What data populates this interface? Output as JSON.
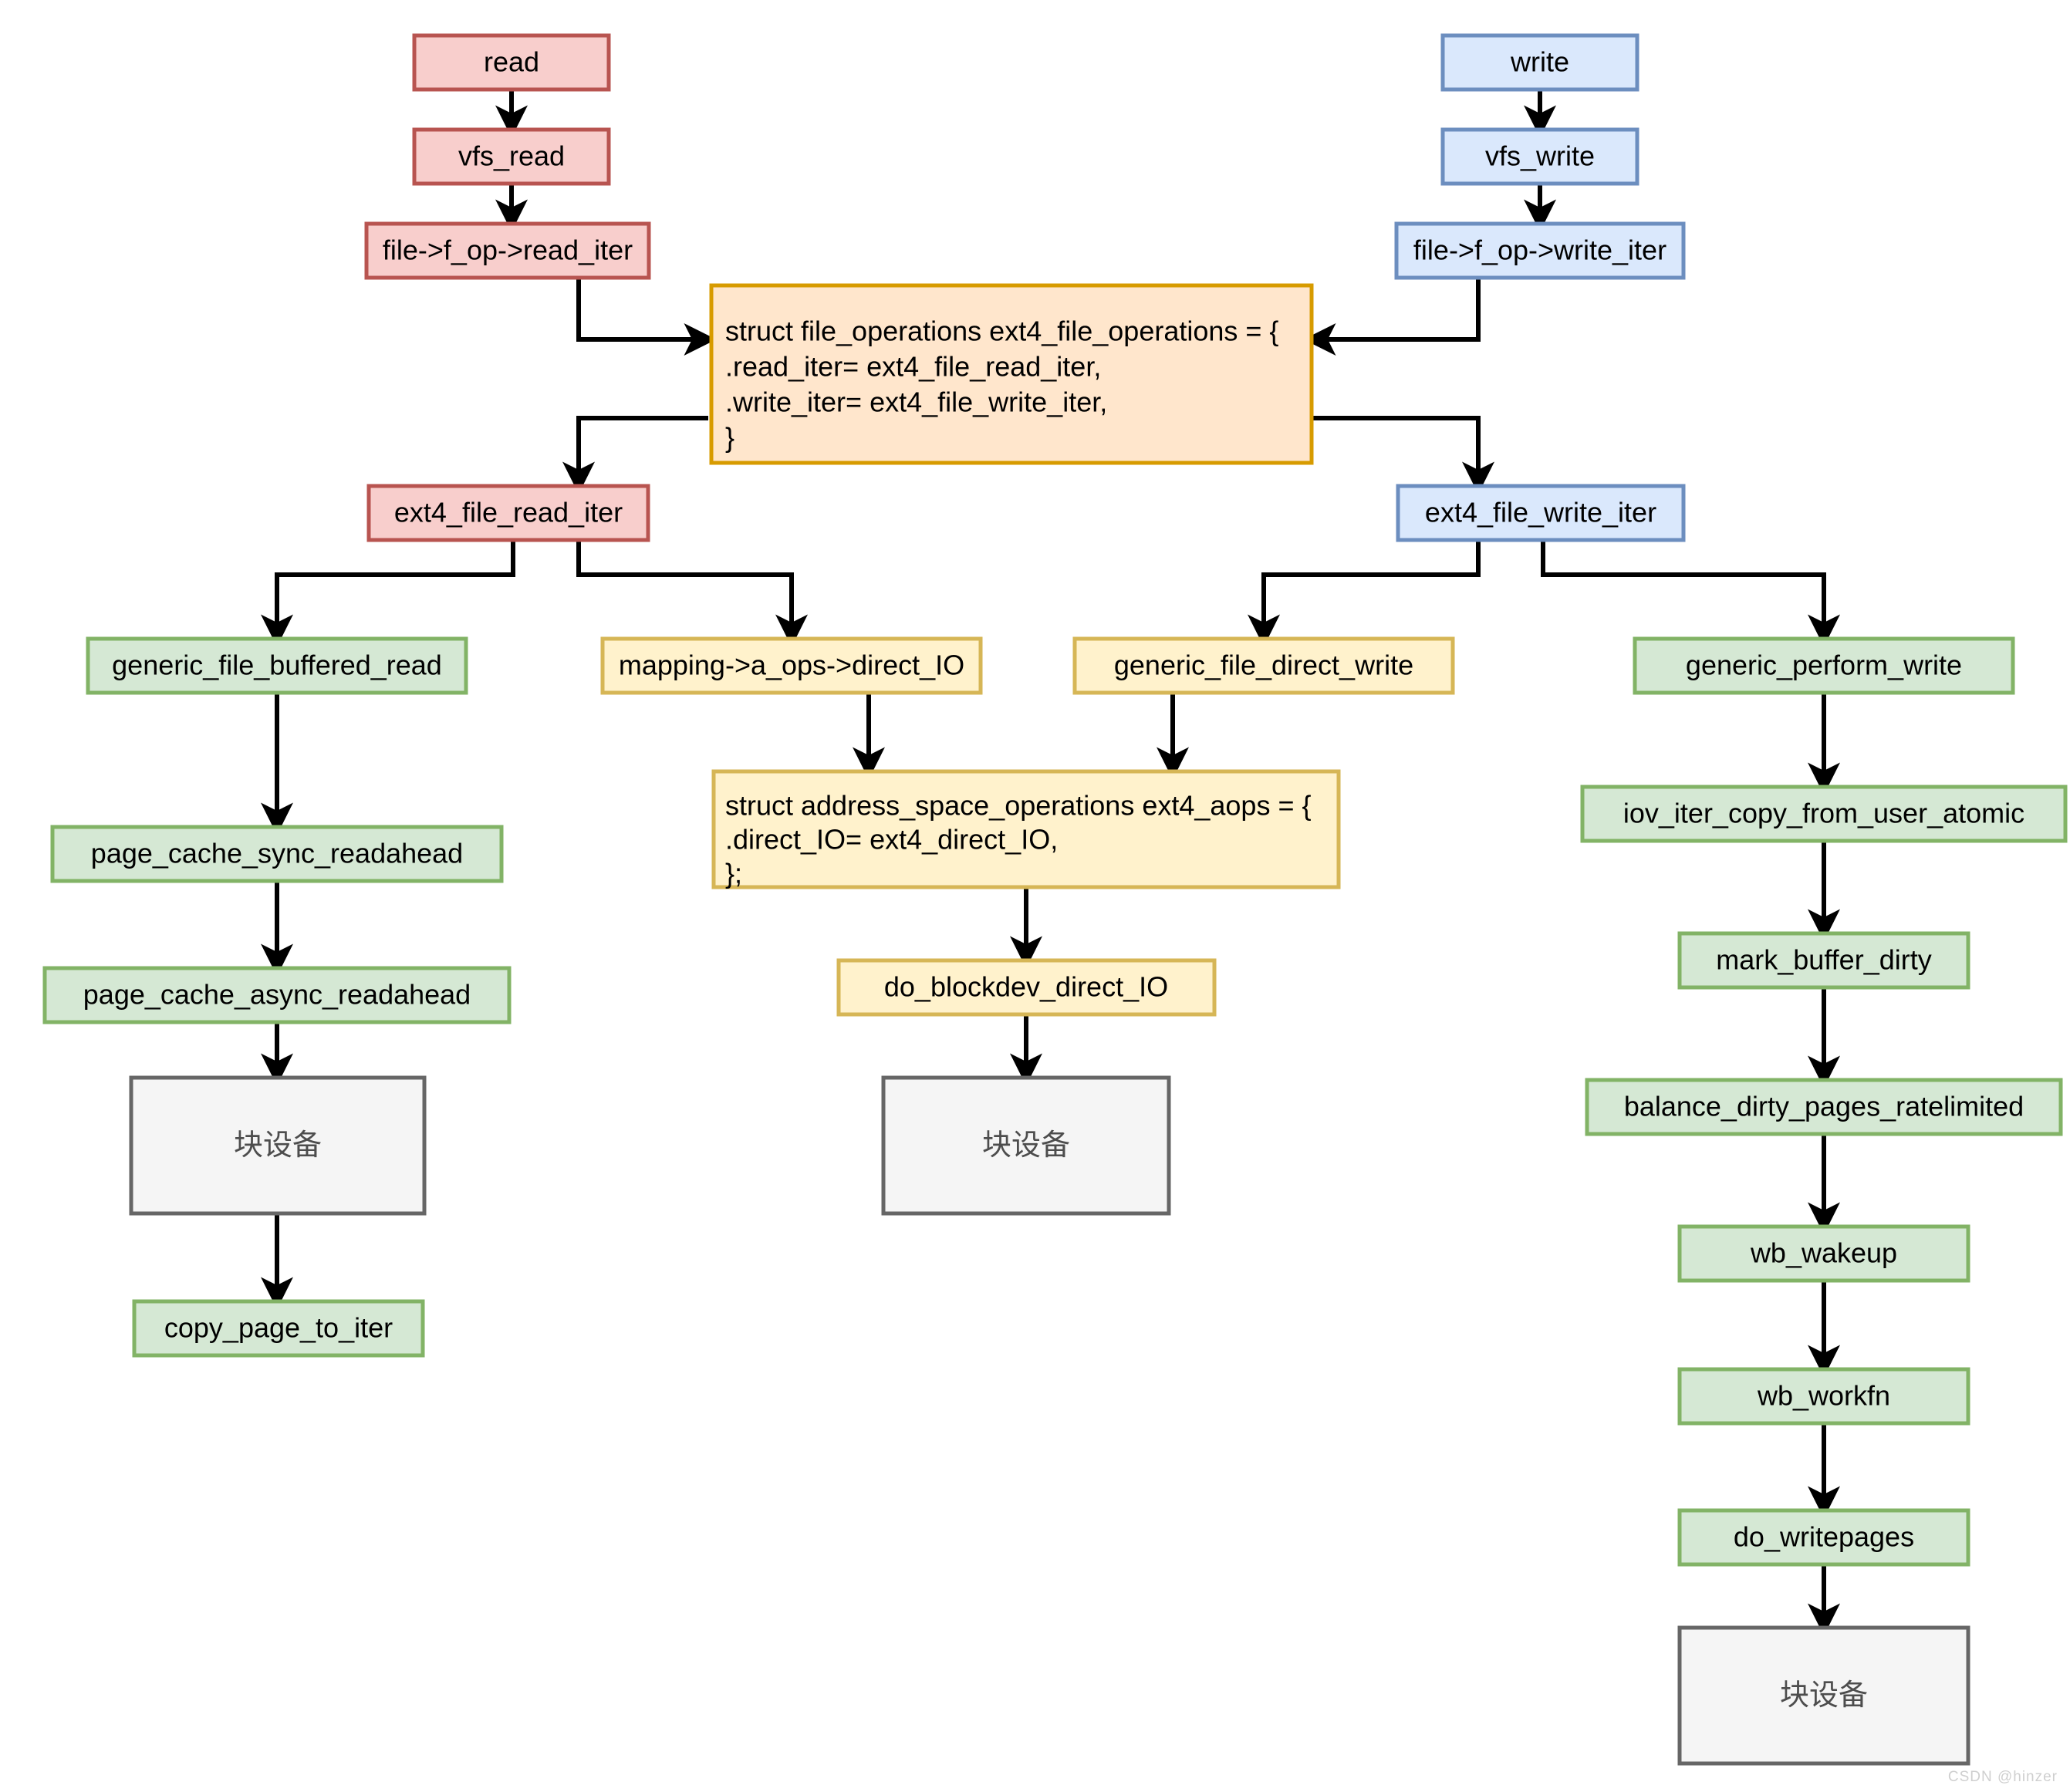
{
  "diagram": {
    "title": "ext4 read/write call path flowchart",
    "watermark": "CSDN @hinzer",
    "palette": {
      "read_fill": "#f8cecc",
      "read_stroke": "#b85450",
      "write_fill": "#dae8fc",
      "write_stroke": "#6c8ebf",
      "struct_fill": "#ffe6cc",
      "struct_stroke": "#d79b00",
      "yellow_fill": "#fff2cc",
      "yellow_stroke": "#d6b656",
      "green_fill": "#d5e8d4",
      "green_stroke": "#82b366",
      "device_fill": "#f5f5f5",
      "device_stroke": "#666666",
      "edge": "#000000"
    },
    "nodes": {
      "read": {
        "label": "read",
        "kind": "read"
      },
      "vfs_read": {
        "label": "vfs_read",
        "kind": "read"
      },
      "file_f_op_read_iter": {
        "label": "file->f_op->read_iter",
        "kind": "read"
      },
      "write": {
        "label": "write",
        "kind": "write"
      },
      "vfs_write": {
        "label": "vfs_write",
        "kind": "write"
      },
      "file_f_op_write_iter": {
        "label": "file->f_op->write_iter",
        "kind": "write"
      },
      "file_operations_struct": {
        "kind": "struct",
        "lines": [
          "struct file_operations ext4_file_operations = {",
          ".read_iter= ext4_file_read_iter,",
          ".write_iter= ext4_file_write_iter,",
          "}"
        ]
      },
      "ext4_file_read_iter": {
        "label": "ext4_file_read_iter",
        "kind": "read"
      },
      "ext4_file_write_iter": {
        "label": "ext4_file_write_iter",
        "kind": "write"
      },
      "generic_file_buffered_read": {
        "label": "generic_file_buffered_read",
        "kind": "green"
      },
      "mapping_a_ops_direct_IO": {
        "label": "mapping->a_ops->direct_IO",
        "kind": "yellow"
      },
      "generic_file_direct_write": {
        "label": "generic_file_direct_write",
        "kind": "yellow"
      },
      "generic_perform_write": {
        "label": "generic_perform_write",
        "kind": "green"
      },
      "page_cache_sync_readahead": {
        "label": "page_cache_sync_readahead",
        "kind": "green"
      },
      "page_cache_async_readahead": {
        "label": "page_cache_async_readahead",
        "kind": "green"
      },
      "address_space_operations_struct": {
        "kind": "yellow",
        "lines": [
          "struct address_space_operations ext4_aops = {",
          ".direct_IO= ext4_direct_IO,",
          "};"
        ]
      },
      "do_blockdev_direct_IO": {
        "label": "do_blockdev_direct_IO",
        "kind": "yellow"
      },
      "iov_iter_copy_from_user_atomic": {
        "label": "iov_iter_copy_from_user_atomic",
        "kind": "green"
      },
      "mark_buffer_dirty": {
        "label": "mark_buffer_dirty",
        "kind": "green"
      },
      "balance_dirty_pages_ratelimited": {
        "label": "balance_dirty_pages_ratelimited",
        "kind": "green"
      },
      "wb_wakeup": {
        "label": "wb_wakeup",
        "kind": "green"
      },
      "wb_workfn": {
        "label": "wb_workfn",
        "kind": "green"
      },
      "do_writepages": {
        "label": "do_writepages",
        "kind": "green"
      },
      "block_device_read": {
        "label": "块设备",
        "kind": "device"
      },
      "block_device_direct": {
        "label": "块设备",
        "kind": "device"
      },
      "block_device_write": {
        "label": "块设备",
        "kind": "device"
      },
      "copy_page_to_iter": {
        "label": "copy_page_to_iter",
        "kind": "green"
      }
    },
    "edges": [
      {
        "from": "read",
        "to": "vfs_read"
      },
      {
        "from": "vfs_read",
        "to": "file_f_op_read_iter"
      },
      {
        "from": "file_f_op_read_iter",
        "to": "file_operations_struct"
      },
      {
        "from": "write",
        "to": "vfs_write"
      },
      {
        "from": "vfs_write",
        "to": "file_f_op_write_iter"
      },
      {
        "from": "file_f_op_write_iter",
        "to": "file_operations_struct"
      },
      {
        "from": "file_operations_struct",
        "to": "ext4_file_read_iter"
      },
      {
        "from": "file_operations_struct",
        "to": "ext4_file_write_iter"
      },
      {
        "from": "ext4_file_read_iter",
        "to": "generic_file_buffered_read"
      },
      {
        "from": "ext4_file_read_iter",
        "to": "mapping_a_ops_direct_IO"
      },
      {
        "from": "ext4_file_write_iter",
        "to": "generic_file_direct_write"
      },
      {
        "from": "ext4_file_write_iter",
        "to": "generic_perform_write"
      },
      {
        "from": "generic_file_buffered_read",
        "to": "page_cache_sync_readahead"
      },
      {
        "from": "page_cache_sync_readahead",
        "to": "page_cache_async_readahead"
      },
      {
        "from": "page_cache_async_readahead",
        "to": "block_device_read"
      },
      {
        "from": "block_device_read",
        "to": "copy_page_to_iter"
      },
      {
        "from": "mapping_a_ops_direct_IO",
        "to": "address_space_operations_struct"
      },
      {
        "from": "generic_file_direct_write",
        "to": "address_space_operations_struct"
      },
      {
        "from": "address_space_operations_struct",
        "to": "do_blockdev_direct_IO"
      },
      {
        "from": "do_blockdev_direct_IO",
        "to": "block_device_direct"
      },
      {
        "from": "generic_perform_write",
        "to": "iov_iter_copy_from_user_atomic"
      },
      {
        "from": "iov_iter_copy_from_user_atomic",
        "to": "mark_buffer_dirty"
      },
      {
        "from": "mark_buffer_dirty",
        "to": "balance_dirty_pages_ratelimited"
      },
      {
        "from": "balance_dirty_pages_ratelimited",
        "to": "wb_wakeup"
      },
      {
        "from": "wb_wakeup",
        "to": "wb_workfn"
      },
      {
        "from": "wb_workfn",
        "to": "do_writepages"
      },
      {
        "from": "do_writepages",
        "to": "block_device_write"
      }
    ]
  }
}
